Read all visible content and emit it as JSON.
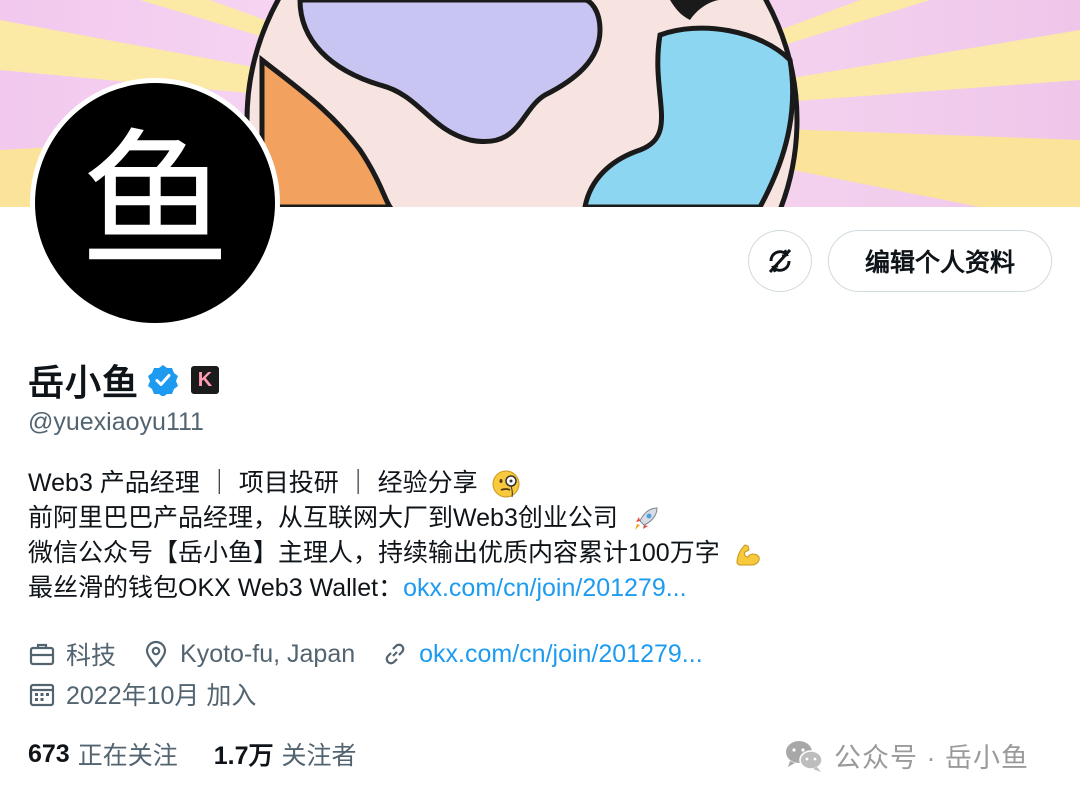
{
  "profile": {
    "avatar_char": "鱼",
    "display_name": "岳小鱼",
    "handle": "@yuexiaoyu111",
    "badge_char": "K",
    "edit_button_label": "编辑个人资料",
    "icons": {
      "verified": "verified-badge-icon",
      "badge": "k-badge-icon",
      "switch": "no-sync-icon"
    },
    "colors": {
      "link": "#1d9bf0",
      "verified": "#1d9bf0",
      "secondary_text": "#536471"
    }
  },
  "bio": {
    "line1": "Web3 产品经理 ｜ 项目投研 ｜ 经验分享",
    "line2": "前阿里巴巴产品经理，从互联网大厂到Web3创业公司",
    "line3": "微信公众号【岳小鱼】主理人，持续输出优质内容累计100万字",
    "line4_text": "最丝滑的钱包OKX Web3 Wallet：",
    "line4_link": "okx.com/cn/join/201279..."
  },
  "meta": {
    "category": "科技",
    "location": "Kyoto-fu, Japan",
    "website": "okx.com/cn/join/201279...",
    "joined": "2022年10月 加入"
  },
  "stats": {
    "following_count": "673",
    "following_label": "正在关注",
    "followers_count": "1.7万",
    "followers_label": "关注者"
  },
  "watermark": {
    "text": "公众号 · 岳小鱼",
    "icon": "wechat-icon"
  }
}
